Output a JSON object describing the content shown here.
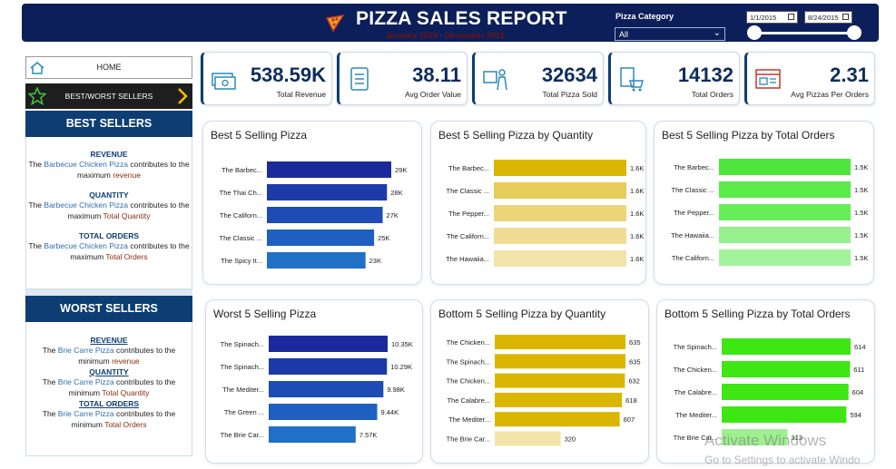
{
  "header": {
    "title": "PIZZA SALES REPORT",
    "subtitle": "January 2015 - December 2015",
    "category_label": "Pizza Category",
    "category_value": "All",
    "date_start": "1/1/2015",
    "date_end": "8/24/2015"
  },
  "nav": {
    "home_label": "HOME",
    "bestworst_label": "BEST/WORST SELLERS"
  },
  "best_sellers": {
    "heading": "BEST SELLERS",
    "items": [
      {
        "title": "REVENUE",
        "pre": "The ",
        "pizza": "Barbecue Chicken Pizza",
        "mid": " contributes to the maximum ",
        "metric": "revenue"
      },
      {
        "title": "QUANTITY",
        "pre": "The ",
        "pizza": "Barbecue Chicken Pizza",
        "mid": " contributes to the maximum ",
        "metric": "Total Quantity"
      },
      {
        "title": "TOTAL ORDERS",
        "pre": "The ",
        "pizza": "Barbecue Chicken Pizza",
        "mid": " contributes to the maximum ",
        "metric": "Total Orders"
      }
    ]
  },
  "worst_sellers": {
    "heading": "WORST SELLERS",
    "items": [
      {
        "title": "REVENUE",
        "pre": "The ",
        "pizza": "Brie Carre Pizza",
        "mid": " contributes to the minimum ",
        "metric": "revenue"
      },
      {
        "title": "QUANTITY",
        "pre": "The ",
        "pizza": "Brie Carre Pizza",
        "mid": " contributes to the minimum ",
        "metric": "Total Quantity"
      },
      {
        "title": "TOTAL ORDERS",
        "pre": "The ",
        "pizza": "Brie Carre Pizza",
        "mid": "  contributes to the minimum ",
        "metric": "Total Orders"
      }
    ]
  },
  "kpis": [
    {
      "value": "538.59K",
      "label": "Total Revenue",
      "icon": "money-icon"
    },
    {
      "value": "38.11",
      "label": "Avg Order Value",
      "icon": "checklist-icon"
    },
    {
      "value": "32634",
      "label": "Total Pizza Sold",
      "icon": "delivery-icon"
    },
    {
      "value": "14132",
      "label": "Total Orders",
      "icon": "order-cart-icon"
    },
    {
      "value": "2.31",
      "label": "Avg Pizzas Per Orders",
      "icon": "browser-icon"
    }
  ],
  "chart_data": [
    {
      "type": "bar",
      "orientation": "horizontal",
      "title": "Best 5 Selling Pizza",
      "categories": [
        "The Barbec...",
        "The Thai Ch...",
        "The Californ...",
        "The Classic ...",
        "The Spicy It..."
      ],
      "values": [
        29,
        28,
        27,
        25,
        23
      ],
      "labels": [
        "29K",
        "28K",
        "27K",
        "25K",
        "23K"
      ],
      "colors": [
        "#1a2a9c",
        "#1c3aa8",
        "#1d4db4",
        "#1f5fc0",
        "#2070c8"
      ],
      "xlim": [
        0,
        29
      ]
    },
    {
      "type": "bar",
      "orientation": "horizontal",
      "title": "Best 5 Selling Pizza by Quantity",
      "categories": [
        "The Barbec...",
        "The Classic ...",
        "The Pepper...",
        "The Californ...",
        "The Hawaiia..."
      ],
      "values": [
        1.6,
        1.6,
        1.6,
        1.6,
        1.6
      ],
      "labels": [
        "1.6K",
        "1.6K",
        "1.6K",
        "1.6K",
        "1.6K"
      ],
      "colors": [
        "#dab600",
        "#e6cc5a",
        "#eed57a",
        "#f0dc93",
        "#f2e3a8"
      ],
      "xlim": [
        0,
        1.6
      ]
    },
    {
      "type": "bar",
      "orientation": "horizontal",
      "title": "Best 5 Selling Pizza by Total Orders",
      "categories": [
        "The Barbec...",
        "The Classic ...",
        "The Pepper...",
        "The Hawaiia...",
        "The Californ..."
      ],
      "values": [
        1.5,
        1.5,
        1.5,
        1.5,
        1.5
      ],
      "labels": [
        "1.5K",
        "1.5K",
        "1.5K",
        "1.5K",
        "1.5K"
      ],
      "colors": [
        "#4ee63c",
        "#5aeb4a",
        "#66ee58",
        "#96f08e",
        "#a3f29c"
      ],
      "xlim": [
        0,
        1.5
      ]
    },
    {
      "type": "bar",
      "orientation": "horizontal",
      "title": "Worst 5 Selling Pizza",
      "categories": [
        "The Spinach...",
        "The Spinach...",
        "The Mediter...",
        "The Green ...",
        "The Brie Car..."
      ],
      "values": [
        10.35,
        10.29,
        9.98,
        9.44,
        7.57
      ],
      "labels": [
        "10.35K",
        "10.29K",
        "9.98K",
        "9.44K",
        "7.57K"
      ],
      "colors": [
        "#1a2a9c",
        "#1c3aa8",
        "#1d4db4",
        "#1f5fc0",
        "#2070c8"
      ],
      "xlim": [
        0,
        10.35
      ]
    },
    {
      "type": "bar",
      "orientation": "horizontal",
      "title": "Bottom 5 Selling Pizza by Quantity",
      "categories": [
        "The Chicken...",
        "The Spinach...",
        "The Chicken...",
        "The Calabre...",
        "The Mediter...",
        "The Brie Car..."
      ],
      "values": [
        635,
        635,
        632,
        618,
        607,
        320
      ],
      "labels": [
        "635",
        "635",
        "632",
        "618",
        "607",
        "320"
      ],
      "colors": [
        "#dab600",
        "#dab600",
        "#dab600",
        "#dab600",
        "#dab600",
        "#f2e3a8"
      ],
      "xlim": [
        0,
        635
      ]
    },
    {
      "type": "bar",
      "orientation": "horizontal",
      "title": "Bottom 5 Selling Pizza by Total Orders",
      "categories": [
        "The Spinach...",
        "The Chicken...",
        "The Calabre...",
        "The Mediter...",
        "The Brie Car..."
      ],
      "values": [
        614,
        611,
        604,
        594,
        313
      ],
      "labels": [
        "614",
        "611",
        "604",
        "594",
        "313"
      ],
      "colors": [
        "#3ee614",
        "#3ee614",
        "#3ee614",
        "#3ee614",
        "#9ef090"
      ],
      "xlim": [
        0,
        614
      ]
    }
  ],
  "watermark": {
    "line1": "Activate Windows",
    "line2": "Go to Settings to activate Windo"
  }
}
